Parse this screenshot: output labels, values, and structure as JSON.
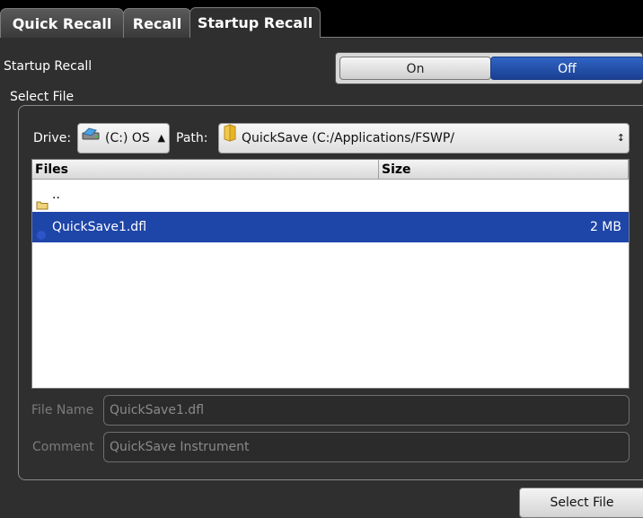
{
  "tabs": [
    {
      "label": "Quick Recall",
      "active": false
    },
    {
      "label": "Recall",
      "active": false
    },
    {
      "label": "Startup Recall",
      "active": true
    }
  ],
  "startup_recall": {
    "label": "Startup Recall",
    "on_label": "On",
    "off_label": "Off",
    "selected": "Off"
  },
  "select_file": {
    "group_label": "Select File",
    "drive_label": "Drive:",
    "drive_value": "(C:) OS",
    "path_label": "Path:",
    "path_value": "QuickSave (C:/Applications/FSWP/"
  },
  "file_list": {
    "columns": [
      "Files",
      "Size"
    ],
    "rows": [
      {
        "name": "..",
        "size": "",
        "icon": "folder-icon",
        "selected": false
      },
      {
        "name": "QuickSave1.dfl",
        "size": "2 MB",
        "icon": "file-icon",
        "selected": true
      }
    ]
  },
  "file_name": {
    "label": "File Name",
    "value": "QuickSave1.dfl"
  },
  "comment": {
    "label": "Comment",
    "value": "QuickSave Instrument"
  },
  "select_file_button": "Select File",
  "colors": {
    "background": "#2f2f2f",
    "selection_blue": "#1e45a8",
    "toggle_off_active": "#1b3f92"
  }
}
